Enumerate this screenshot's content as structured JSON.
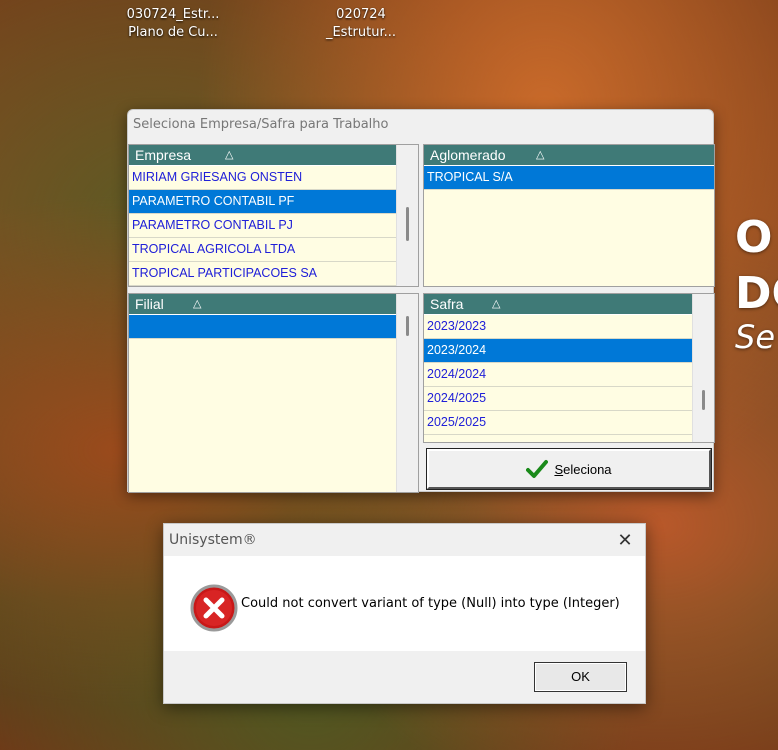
{
  "desktop": {
    "icon1": {
      "line1": "030724_Estr...",
      "line2": "Plano de Cu..."
    },
    "icon2": {
      "line1": "020724",
      "line2": "_Estrutur..."
    },
    "side_text": {
      "l1": "O",
      "l2": "DO",
      "l3": "Se"
    }
  },
  "main_window": {
    "title": "Seleciona Empresa/Safra para Trabalho",
    "empresa": {
      "header": "Empresa",
      "sort_glyph": "△",
      "rows": [
        "MIRIAM GRIESANG ONSTEN",
        "PARAMETRO CONTABIL PF",
        "PARAMETRO CONTABIL PJ",
        "TROPICAL AGRICOLA LTDA",
        "TROPICAL PARTICIPACOES SA"
      ],
      "selected_index": 1
    },
    "aglomerado": {
      "header": "Aglomerado",
      "sort_glyph": "△",
      "rows": [
        "TROPICAL S/A"
      ],
      "selected_index": 0
    },
    "filial": {
      "header": "Filial",
      "sort_glyph": "△",
      "rows": [
        ""
      ],
      "selected_index": 0
    },
    "safra": {
      "header": "Safra",
      "sort_glyph": "△",
      "rows": [
        "2023/2023",
        "2023/2024",
        "2024/2024",
        "2024/2025",
        "2025/2025"
      ],
      "selected_index": 1
    },
    "select_button": {
      "label": "Seleciona",
      "icon": "checkmark-icon"
    }
  },
  "error_dialog": {
    "title": "Unisystem®",
    "message": "Could not convert variant of type (Null) into type (Integer)",
    "ok_label": "OK",
    "icon": "error-icon"
  },
  "colors": {
    "header_bg": "#3f7a77",
    "row_bg": "#fffde3",
    "row_text": "#2020d8",
    "selection": "#0078d7"
  }
}
